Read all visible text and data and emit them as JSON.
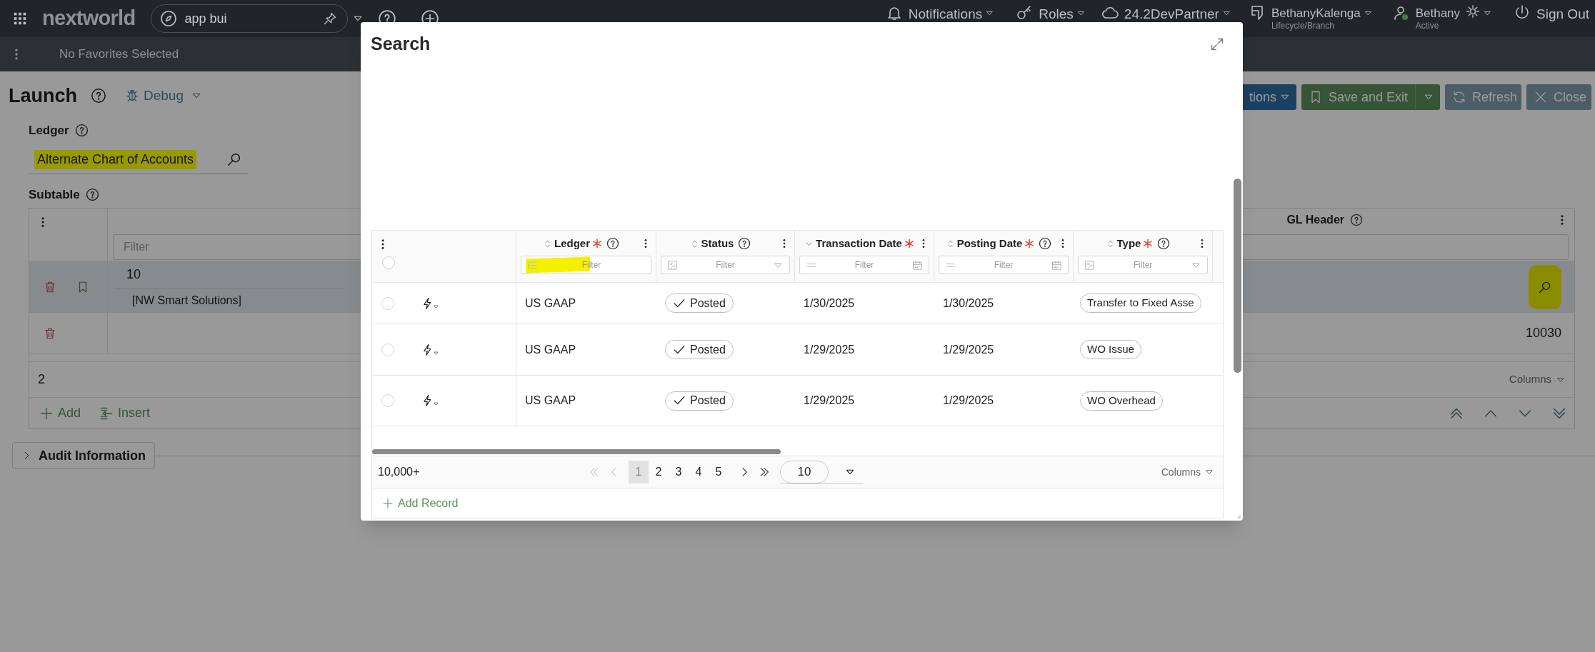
{
  "top_bar": {
    "logo": "nextworld",
    "search": {
      "value": "app bui"
    },
    "nav": [
      {
        "kind": "notifications",
        "label": "Notifications",
        "dropdown": true
      },
      {
        "kind": "roles",
        "label": "Roles",
        "dropdown": true
      },
      {
        "kind": "environment",
        "label": "24.2DevPartner",
        "dropdown": true
      },
      {
        "kind": "lifecycle",
        "label": "BethanyKalenga",
        "sublabel": "Lifecycle/Branch",
        "dropdown": true
      },
      {
        "kind": "user",
        "label": "Bethany",
        "sublabel": "Active",
        "dropdown": true
      },
      {
        "kind": "sign_out",
        "label": "Sign Out",
        "dropdown": false
      }
    ]
  },
  "favorites_bar": {
    "text": "No Favorites Selected"
  },
  "page": {
    "title": "Launch",
    "debug": "Debug",
    "actions": [
      {
        "kind": "menu",
        "label": "tions"
      },
      {
        "kind": "save",
        "label": "Save and Exit"
      },
      {
        "kind": "refresh",
        "label": "Refresh"
      },
      {
        "kind": "close",
        "label": "Close"
      }
    ],
    "ledger": {
      "label": "Ledger",
      "value": "Alternate Chart of Accounts",
      "highlighted": true
    },
    "subtable": {
      "label": "Subtable",
      "filter_placeholder": "Filter",
      "gl_header": "GL Header",
      "rows": [
        {
          "selected": true,
          "bookmarked": true,
          "value": "10",
          "description": "[NW Smart Solutions]",
          "gl_header": {
            "kind": "lookup",
            "highlighted": true
          }
        },
        {
          "selected": false,
          "bookmarked": false,
          "gl_header": {
            "kind": "text",
            "value": "10030"
          }
        }
      ],
      "count": "2",
      "columns_menu": "Columns",
      "actions": [
        "Add",
        "Insert"
      ]
    },
    "audit": {
      "label": "Audit Information",
      "expanded": false
    }
  },
  "modal": {
    "title": "Search",
    "all_selected": false,
    "columns": [
      {
        "label": "Ledger",
        "sorted": false,
        "required": true,
        "help": true,
        "filter": {
          "kind": "lookup",
          "placeholder": "Filter",
          "highlighted": true
        }
      },
      {
        "label": "Status",
        "sorted": false,
        "required": false,
        "help": true,
        "filter": {
          "kind": "select",
          "placeholder": "Filter",
          "highlighted": false
        }
      },
      {
        "label": "Transaction Date",
        "sorted": true,
        "required": true,
        "help": false,
        "filter": {
          "kind": "date",
          "placeholder": "Filter",
          "highlighted": false
        }
      },
      {
        "label": "Posting Date",
        "sorted": false,
        "required": true,
        "help": true,
        "filter": {
          "kind": "date",
          "placeholder": "Filter",
          "highlighted": false
        }
      },
      {
        "label": "Type",
        "sorted": false,
        "required": true,
        "help": true,
        "filter": {
          "kind": "select",
          "placeholder": "Filter",
          "highlighted": false
        }
      }
    ],
    "rows": [
      {
        "selected": false,
        "ledger": "US GAAP",
        "status": {
          "kind": "posted",
          "label": "Posted"
        },
        "transaction_date": "1/30/2025",
        "posting_date": "1/30/2025",
        "type": "Transfer to Fixed Asse"
      },
      {
        "selected": false,
        "ledger": "US GAAP",
        "status": {
          "kind": "posted",
          "label": "Posted"
        },
        "transaction_date": "1/29/2025",
        "posting_date": "1/29/2025",
        "type": "WO Issue"
      },
      {
        "selected": false,
        "ledger": "US GAAP",
        "status": {
          "kind": "posted",
          "label": "Posted"
        },
        "transaction_date": "1/29/2025",
        "posting_date": "1/29/2025",
        "type": "WO Overhead"
      }
    ],
    "footer": {
      "count": "10,000+",
      "pages": [
        {
          "label": "1",
          "selected": true
        },
        {
          "label": "2",
          "selected": false
        },
        {
          "label": "3",
          "selected": false
        },
        {
          "label": "4",
          "selected": false
        },
        {
          "label": "5",
          "selected": false
        }
      ],
      "page_size": "10",
      "columns_menu": "Columns",
      "add_record": "Add Record"
    }
  }
}
